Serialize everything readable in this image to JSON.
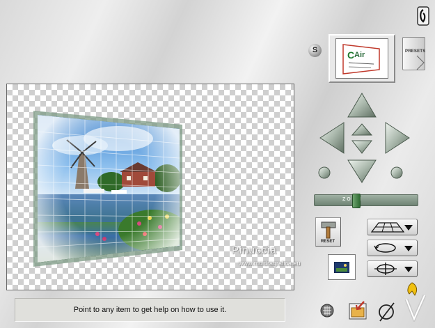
{
  "help": {
    "text": "Point to any item to get help on how to use it."
  },
  "presets": {
    "label": "PRESETS"
  },
  "title_glyph": "S",
  "zoom": {
    "label": "Z O O M",
    "value": 0.4
  },
  "reset": {
    "label": "RESET"
  },
  "watermark": {
    "line1": "Pinuccia",
    "line2": "www.moidragrafica.eu"
  },
  "colors": {
    "zoom_track": "#7d9282",
    "accent_yellow": "#f0c010",
    "sky": "#6aa8e6"
  },
  "icons": {
    "info": "info-icon",
    "help": "hand-help-icon",
    "grid": "grid-icon",
    "open": "folder-arrow-icon",
    "cancel": "cancel-icon",
    "ok": "ok-check-icon"
  }
}
